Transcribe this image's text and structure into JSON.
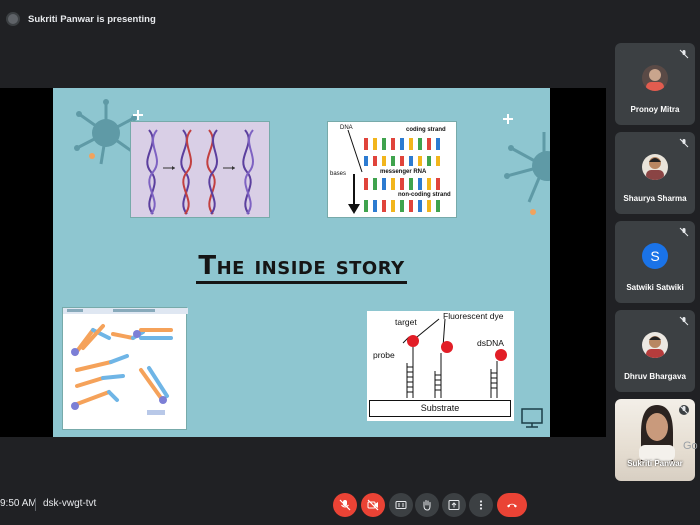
{
  "presenter_banner": "Sukriti Panwar is presenting",
  "slide": {
    "title": "The inside story",
    "rna_image": {
      "dna": "DNA",
      "coding_strand": "coding strand",
      "bases": "bases",
      "messenger_rna": "messenger RNA",
      "non_coding_strand": "non-coding strand"
    },
    "chip_image": {
      "target": "target",
      "fluorescent_dye": "Fluorescent dye",
      "probe": "probe",
      "dsdna": "dsDNA",
      "substrate": "Substrate"
    }
  },
  "participants": [
    {
      "name": "Pronoy Mitra",
      "muted": true
    },
    {
      "name": "Shaurya Sharma",
      "muted": true
    },
    {
      "name": "Satwiki Satwiki",
      "muted": true,
      "initial": "S"
    },
    {
      "name": "Dhruv Bhargava",
      "muted": true
    },
    {
      "name": "Sukriti Panwar",
      "muted": true
    }
  ],
  "bottom": {
    "time": "9:50 AM",
    "meeting_code": "dsk-vwgt-tvt"
  },
  "overlay_text": "Go",
  "colors": {
    "background": "#202124",
    "tile": "#3c4043",
    "slide": "#8ec6d0",
    "danger": "#ea4335",
    "avatar_blue": "#1a73e8"
  }
}
